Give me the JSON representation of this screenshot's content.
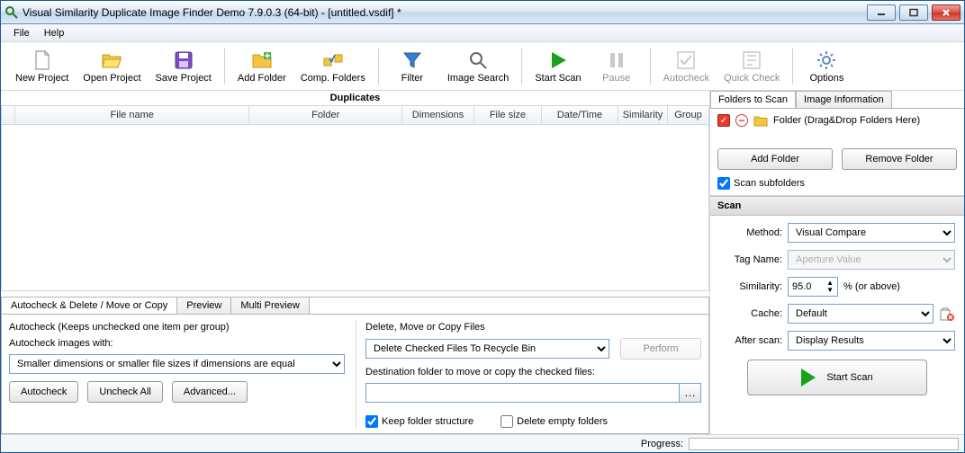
{
  "window": {
    "title": "Visual Similarity Duplicate Image Finder Demo 7.9.0.3 (64-bit) - [untitled.vsdif] *"
  },
  "menubar": {
    "file": "File",
    "help": "Help"
  },
  "toolbar": {
    "new_project": "New Project",
    "open_project": "Open Project",
    "save_project": "Save Project",
    "add_folder": "Add Folder",
    "comp_folders": "Comp. Folders",
    "filter": "Filter",
    "image_search": "Image Search",
    "start_scan": "Start Scan",
    "pause": "Pause",
    "autocheck": "Autocheck",
    "quick_check": "Quick Check",
    "options": "Options"
  },
  "duplicates_label": "Duplicates",
  "columns": {
    "file_name": "File name",
    "folder": "Folder",
    "dimensions": "Dimensions",
    "file_size": "File size",
    "date_time": "Date/Time",
    "similarity": "Similarity",
    "group": "Group"
  },
  "lower_tabs": {
    "main": "Autocheck & Delete / Move or Copy",
    "preview": "Preview",
    "multi_preview": "Multi Preview"
  },
  "autocheck": {
    "heading": "Autocheck (Keeps unchecked one item per group)",
    "with_label": "Autocheck images with:",
    "criterion": "Smaller dimensions or smaller file sizes if dimensions are equal",
    "btn_autocheck": "Autocheck",
    "btn_uncheck": "Uncheck All",
    "btn_advanced": "Advanced..."
  },
  "dmc": {
    "heading": "Delete, Move or Copy Files",
    "action": "Delete Checked Files To Recycle Bin",
    "perform": "Perform",
    "dest_label": "Destination folder to move or copy the checked files:",
    "keep_folder": "Keep folder structure",
    "delete_empty": "Delete empty folders",
    "keep_checked": true,
    "delete_checked": false
  },
  "right_tabs": {
    "folders": "Folders to Scan",
    "info": "Image Information"
  },
  "right": {
    "hint": "Folder (Drag&Drop Folders Here)",
    "add_folder": "Add Folder",
    "remove_folder": "Remove Folder",
    "scan_subfolders": "Scan subfolders",
    "scan_checked": true,
    "scan_hdr": "Scan",
    "method_label": "Method:",
    "method": "Visual Compare",
    "tag_label": "Tag Name:",
    "tag": "Aperture Value",
    "sim_label": "Similarity:",
    "sim_value": "95.0",
    "sim_suffix": "%  (or above)",
    "cache_label": "Cache:",
    "cache": "Default",
    "after_label": "After scan:",
    "after": "Display Results",
    "start_scan": "Start Scan"
  },
  "status": {
    "progress_label": "Progress:"
  }
}
